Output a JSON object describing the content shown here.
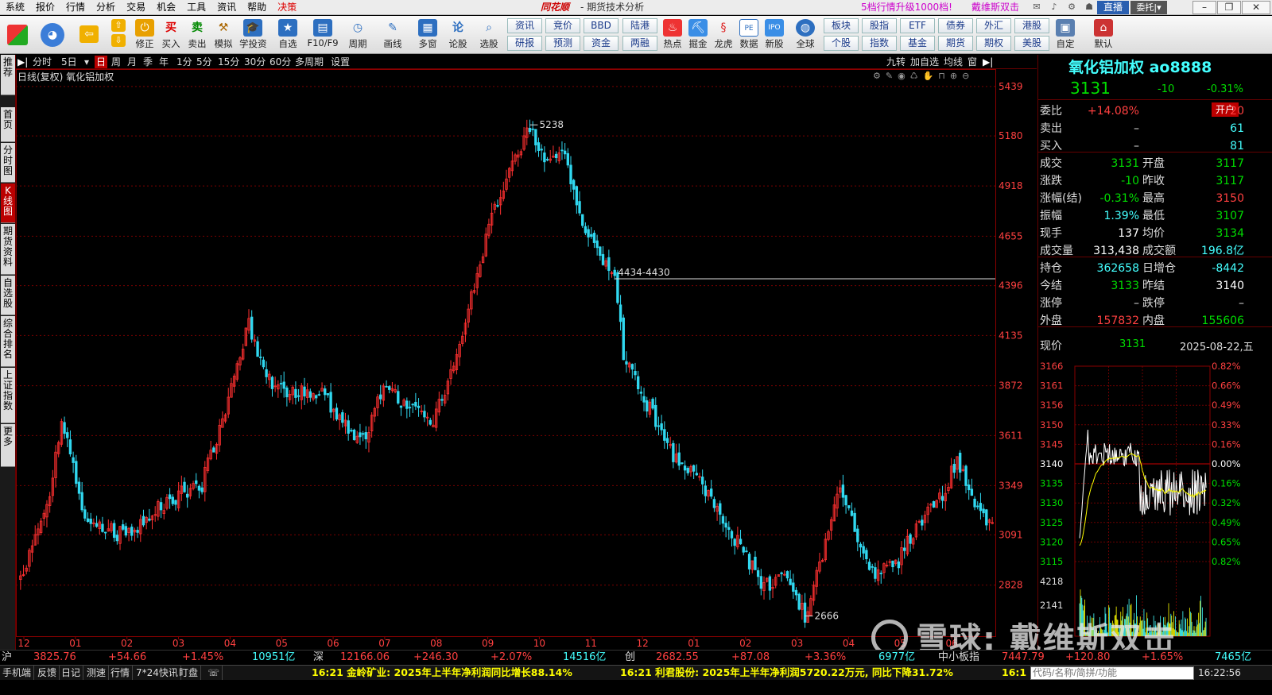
{
  "menubar": {
    "items": [
      "系统",
      "报价",
      "行情",
      "分析",
      "交易",
      "机会",
      "工具",
      "资讯",
      "帮助"
    ],
    "hot_item": "决策",
    "brand": "同花顺",
    "window_title": "- 期货技术分析",
    "promo": "5档行情升级1000档!",
    "user": "戴维斯双击",
    "live_button": "直播",
    "entrust_button": "委托|▾"
  },
  "toolbar": {
    "big_buttons": [
      "修正",
      "买入",
      "卖出",
      "模拟",
      "学投资",
      "自选",
      "F10/F9",
      "周期",
      "画线",
      "多窗",
      "论股",
      "选股",
      "热点",
      "掘金",
      "龙虎",
      "数据",
      "新股",
      "全球",
      "自定",
      "默认"
    ],
    "small_buttons_top": [
      "资讯",
      "竞价",
      "BBD",
      "陆港",
      "板块",
      "股指",
      "ETF",
      "债券",
      "外汇",
      "港股"
    ],
    "small_buttons_bottom": [
      "研报",
      "预测",
      "资金",
      "两融",
      "个股",
      "指数",
      "基金",
      "期货",
      "期权",
      "美股"
    ]
  },
  "left_tabs": [
    "推荐",
    "首页",
    "分时图",
    "K线图",
    "期货资料",
    "自选股",
    "综合排名",
    "上证指数",
    "更多"
  ],
  "left_tab_active": "K线图",
  "chart_toolbar": {
    "periods": [
      "分时",
      "5日",
      "日",
      "周",
      "月",
      "季",
      "年",
      "1分",
      "5分",
      "15分",
      "30分",
      "60分",
      "多周期",
      "设置"
    ],
    "selected_period": "日",
    "right": [
      "九转",
      "加自选",
      "均线",
      "窗"
    ]
  },
  "chart_title": "日线(复权) 氧化铝加权",
  "chart_data": {
    "type": "candlestick",
    "title": "日线(复权) 氧化铝加权",
    "x_ticks": [
      "12",
      "01",
      "02",
      "03",
      "04",
      "05",
      "06",
      "07",
      "08",
      "09",
      "10",
      "11",
      "12",
      "01",
      "02",
      "03",
      "04",
      "05",
      "06"
    ],
    "y_ticks": [
      5439,
      5180,
      4918,
      4655,
      4396,
      4135,
      3872,
      3611,
      3349,
      3091,
      2828
    ],
    "ylim": [
      2560,
      5530
    ],
    "annotations": [
      {
        "text": "5238",
        "value": 5238
      },
      {
        "text": "4434-4430",
        "value": 4432
      },
      {
        "text": "2666",
        "value": 2666
      }
    ],
    "key_points": [
      {
        "index": 0,
        "value": 2860
      },
      {
        "index": 10,
        "value": 3320
      },
      {
        "index": 14,
        "value": 3700
      },
      {
        "index": 22,
        "value": 3180
      },
      {
        "index": 36,
        "value": 3080
      },
      {
        "index": 50,
        "value": 3260
      },
      {
        "index": 62,
        "value": 3360
      },
      {
        "index": 70,
        "value": 3760
      },
      {
        "index": 78,
        "value": 4200
      },
      {
        "index": 84,
        "value": 3900
      },
      {
        "index": 92,
        "value": 3820
      },
      {
        "index": 102,
        "value": 3850
      },
      {
        "index": 110,
        "value": 3700
      },
      {
        "index": 116,
        "value": 3560
      },
      {
        "index": 124,
        "value": 3850
      },
      {
        "index": 132,
        "value": 3780
      },
      {
        "index": 140,
        "value": 3650
      },
      {
        "index": 148,
        "value": 3990
      },
      {
        "index": 154,
        "value": 4340
      },
      {
        "index": 160,
        "value": 4700
      },
      {
        "index": 166,
        "value": 4980
      },
      {
        "index": 170,
        "value": 5110
      },
      {
        "index": 174,
        "value": 5238
      },
      {
        "index": 180,
        "value": 5030
      },
      {
        "index": 186,
        "value": 5120
      },
      {
        "index": 192,
        "value": 4680
      },
      {
        "index": 198,
        "value": 4540
      },
      {
        "index": 203,
        "value": 4432
      },
      {
        "index": 206,
        "value": 4040
      },
      {
        "index": 214,
        "value": 3780
      },
      {
        "index": 222,
        "value": 3520
      },
      {
        "index": 230,
        "value": 3420
      },
      {
        "index": 238,
        "value": 3200
      },
      {
        "index": 246,
        "value": 3030
      },
      {
        "index": 254,
        "value": 2830
      },
      {
        "index": 262,
        "value": 2860
      },
      {
        "index": 268,
        "value": 2666
      },
      {
        "index": 274,
        "value": 3000
      },
      {
        "index": 280,
        "value": 3350
      },
      {
        "index": 286,
        "value": 3060
      },
      {
        "index": 292,
        "value": 2880
      },
      {
        "index": 300,
        "value": 2960
      },
      {
        "index": 306,
        "value": 3120
      },
      {
        "index": 314,
        "value": 3270
      },
      {
        "index": 320,
        "value": 3500
      },
      {
        "index": 326,
        "value": 3240
      },
      {
        "index": 332,
        "value": 3131
      }
    ]
  },
  "quote": {
    "name": "氧化铝加权 ao8888",
    "price": "3131",
    "change": "-10",
    "pct": "-0.31%",
    "open_button": "开户",
    "rows": [
      {
        "k1": "委比",
        "v1": "+14.08%",
        "c1": "#ff4040",
        "k2": "",
        "v2": "20",
        "c2": "#ff4040"
      },
      {
        "k1": "卖出",
        "v1": "–",
        "c1": "#ddd",
        "k2": "",
        "v2": "61",
        "c2": "#4ff"
      },
      {
        "k1": "买入",
        "v1": "–",
        "c1": "#ddd",
        "k2": "",
        "v2": "81",
        "c2": "#4ff"
      },
      {
        "k1": "成交",
        "v1": "3131",
        "c1": "#0d0",
        "k2": "开盘",
        "v2": "3117",
        "c2": "#0d0"
      },
      {
        "k1": "涨跌",
        "v1": "-10",
        "c1": "#0d0",
        "k2": "昨收",
        "v2": "3117",
        "c2": "#0d0"
      },
      {
        "k1": "涨幅(结)",
        "v1": "-0.31%",
        "c1": "#0d0",
        "k2": "最高",
        "v2": "3150",
        "c2": "#ff4040"
      },
      {
        "k1": "振幅",
        "v1": "1.39%",
        "c1": "#4ff",
        "k2": "最低",
        "v2": "3107",
        "c2": "#0d0"
      },
      {
        "k1": "现手",
        "v1": "137",
        "c1": "#fff",
        "k2": "均价",
        "v2": "3134",
        "c2": "#0d0"
      },
      {
        "k1": "成交量",
        "v1": "313,438",
        "c1": "#fff",
        "k2": "成交额",
        "v2": "196.8亿",
        "c2": "#4ff"
      },
      {
        "k1": "持仓",
        "v1": "362658",
        "c1": "#4ff",
        "k2": "日增仓",
        "v2": "-8442",
        "c2": "#4ff"
      },
      {
        "k1": "今结",
        "v1": "3133",
        "c1": "#0d0",
        "k2": "昨结",
        "v2": "3140",
        "c2": "#fff"
      },
      {
        "k1": "涨停",
        "v1": "–",
        "c1": "#ddd",
        "k2": "跌停",
        "v2": "–",
        "c2": "#ddd"
      },
      {
        "k1": "外盘",
        "v1": "157832",
        "c1": "#ff4040",
        "k2": "内盘",
        "v2": "155606",
        "c2": "#0d0"
      }
    ],
    "now_label": "现价",
    "now_value": "3131",
    "date": "2025-08-22,五"
  },
  "tick_chart": {
    "price_ticks": [
      "3166",
      "3161",
      "3156",
      "3150",
      "3145",
      "3140",
      "3135",
      "3130",
      "3125",
      "3120",
      "3115"
    ],
    "pct_ticks": [
      "0.82%",
      "0.66%",
      "0.49%",
      "0.33%",
      "0.16%",
      "0.00%",
      "0.16%",
      "0.32%",
      "0.49%",
      "0.65%",
      "0.82%"
    ],
    "vol_ticks": [
      "4218",
      "2141"
    ]
  },
  "indices": [
    {
      "name": "沪",
      "value": "3825.76",
      "chg": "+54.66",
      "pct": "+1.45%",
      "amt": "10951亿"
    },
    {
      "name": "深",
      "value": "12166.06",
      "chg": "+246.30",
      "pct": "+2.07%",
      "amt": "14516亿"
    },
    {
      "name": "创",
      "value": "2682.55",
      "chg": "+87.08",
      "pct": "+3.36%",
      "amt": "6977亿"
    },
    {
      "name": "中小板指",
      "value": "7447.79",
      "chg": "+120.80",
      "pct": "+1.65%",
      "amt": "7465亿"
    }
  ],
  "bottom": {
    "items": [
      "手机端",
      "反馈",
      "日记",
      "测速",
      "行情",
      "7*24快讯",
      "盯盘"
    ],
    "news1": "16:21 金岭矿业: 2025年上半年净利润同比增长88.14%",
    "news2": "16:21 利君股份: 2025年上半年净利润5720.22万元, 同比下降31.72%",
    "news3": "16:1",
    "code_placeholder": "代码/名称/简拼/功能",
    "clock": "16:22:56"
  },
  "watermark": "雪球: 戴维斯双击"
}
